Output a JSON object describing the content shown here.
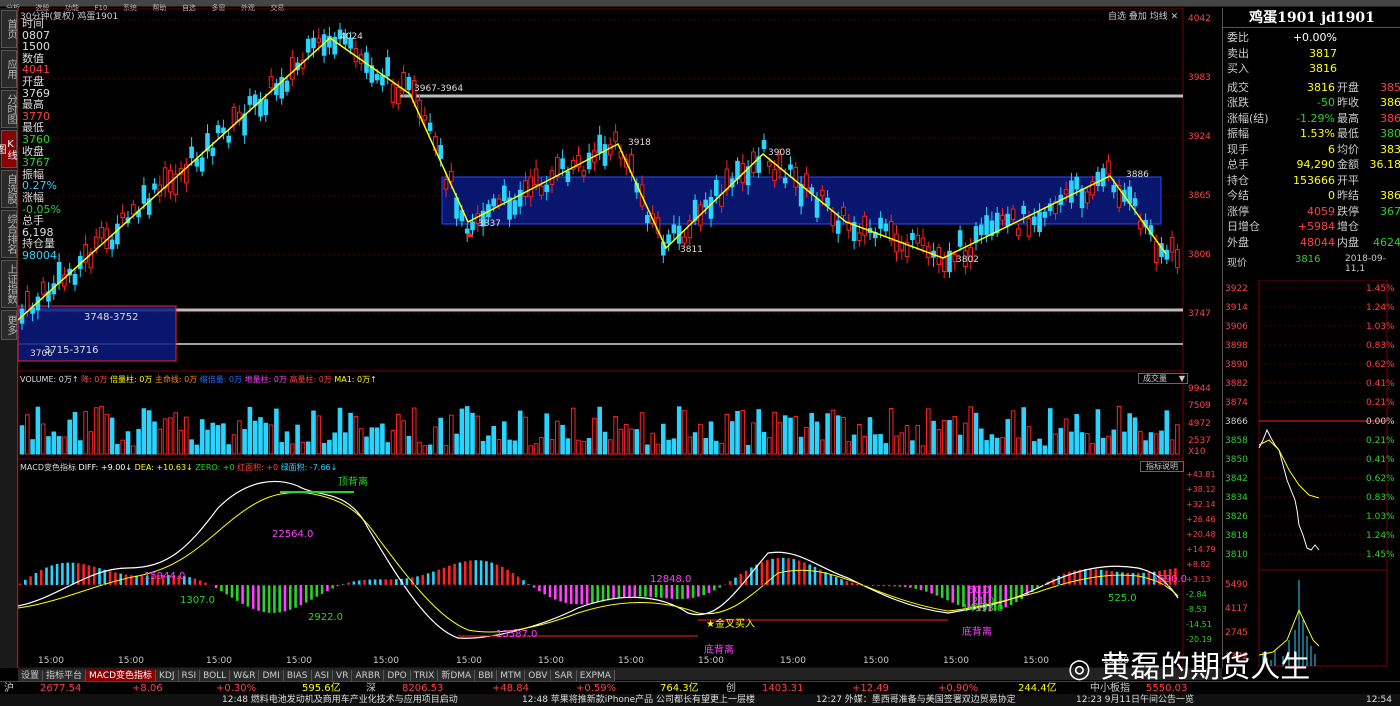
{
  "topbar": {
    "items": [
      "分析",
      "选股",
      "功能",
      "F10",
      "系统",
      "帮助",
      "自选",
      "多窗",
      "外观",
      "交易"
    ]
  },
  "left_tabs": [
    "首页",
    "应用",
    "分时图",
    "K线图",
    "自选股",
    "综合排名",
    "上证指数",
    "更多"
  ],
  "chart": {
    "period_label": "30分钟(复权)",
    "symbol": "鸡蛋1901",
    "toolbar": {
      "self_select": "自选",
      "overlay": "叠加",
      "rights": "均线"
    },
    "info": {
      "time_label": "时间",
      "time_value1": "0807",
      "time_value2": "1500",
      "value_label": "数值",
      "value": "4041",
      "open_label": "开盘",
      "open": "3769",
      "high_label": "最高",
      "high": "3770",
      "low_label": "最低",
      "low": "3760",
      "close_label": "收盘",
      "close": "3767",
      "amp_label": "振幅",
      "amp": "0.27%",
      "chg_label": "涨幅",
      "chg": "-0.05%",
      "vol_label": "总手",
      "vol": "6,198",
      "oi_label": "持仓量",
      "oi": "98004"
    },
    "price_axis": [
      "4042",
      "3983",
      "3924",
      "3865",
      "3806",
      "3747"
    ],
    "annotations": [
      "4024",
      "3967-3964",
      "3918",
      "3908",
      "3886",
      "3837",
      "3811",
      "3802",
      "3748-3752",
      "3715-3716",
      "3706"
    ],
    "volume_header": {
      "volume": "VOLUME: 0万↑",
      "a": "降: 0万",
      "b": "倍量柱: 0万",
      "c": "主命线: 0万",
      "d": "缩倍量: 0万",
      "e": "地量柱: 0万",
      "f": "高量柱: 0万",
      "g": "MA1: 0万↑"
    },
    "volume_axis": [
      "9944",
      "7509",
      "4972",
      "2537",
      "X10"
    ],
    "volume_dropdown": "成交量",
    "macd_header": {
      "name": "MACD变色指标",
      "diff": "DIFF: +9.00↓",
      "dea": "DEA: +10.63↓",
      "zero": "ZERO: +0",
      "red": "红面积: +0",
      "green": "绿面积: -7.66↓"
    },
    "macd_help": "指标说明",
    "macd_axis": [
      "+43.81",
      "+38.12",
      "+32.14",
      "+26.46",
      "+20.48",
      "+14.79",
      "+8.82",
      "+3.13",
      "-2.84",
      "-8.53",
      "-14.51",
      "-20.19"
    ],
    "macd_annotations": [
      "顶背离",
      "22564.0",
      "15944.0",
      "1307.0",
      "2922.0",
      "12848.0",
      "13587.0",
      "金叉买入",
      "底背离",
      "50.0",
      "21.0",
      "14993.0",
      "底背离",
      "525.0",
      "5590.0"
    ],
    "time_axis": [
      "15:00",
      "15:00",
      "15:00",
      "15:00",
      "15:00",
      "15:00",
      "15:00",
      "15:00",
      "15:00",
      "15:00",
      "15:00",
      "15:00",
      "15:00",
      "15:00",
      "15:00",
      "15:00",
      "15:00",
      "15:00",
      "15:00",
      "15:00",
      "15:00",
      "15:00"
    ]
  },
  "bottom_tabs": [
    "设置",
    "指标平台",
    "MACD变色指标",
    "KDJ",
    "RSI",
    "BOLL",
    "W&R",
    "DMI",
    "BIAS",
    "ASI",
    "VR",
    "ARBR",
    "DPO",
    "TRIX",
    "新DMA",
    "BBI",
    "MTM",
    "OBV",
    "SAR",
    "EXPMA"
  ],
  "right_panel": {
    "title": "鸡蛋1901 jd1901",
    "rows": [
      {
        "l": "委比",
        "v": "+0.00%",
        "vc": "#ffffff"
      },
      {
        "l": "卖出",
        "v": "3817",
        "vc": "#ffff00"
      },
      {
        "l": "买入",
        "v": "3816",
        "vc": "#ffff00"
      },
      {
        "l": "成交",
        "v": "3816",
        "vc": "#ffff00",
        "l2": "开盘",
        "v2": "385",
        "v2c": "#ff4040"
      },
      {
        "l": "涨跌",
        "v": "-50",
        "vc": "#29d429",
        "l2": "昨收",
        "v2": "386",
        "v2c": "#ffff00"
      },
      {
        "l": "涨幅(结)",
        "v": "-1.29%",
        "vc": "#29d429",
        "l2": "最高",
        "v2": "386",
        "v2c": "#ff4040"
      },
      {
        "l": "振幅",
        "v": "1.53%",
        "vc": "#ffff00",
        "l2": "最低",
        "v2": "380",
        "v2c": "#29d429"
      },
      {
        "l": "现手",
        "v": "6",
        "vc": "#ffff00",
        "l2": "均价",
        "v2": "383",
        "v2c": "#ffff00"
      },
      {
        "l": "总手",
        "v": "94,290",
        "vc": "#ffff00",
        "l2": "金额",
        "v2": "36.18",
        "v2c": "#ffff00"
      },
      {
        "l": "持仓",
        "v": "153666",
        "vc": "#ffff00",
        "l2": "开平",
        "v2": "",
        "v2c": "#ffff00"
      },
      {
        "l": "今结",
        "v": "0",
        "vc": "#ffff00",
        "l2": "昨结",
        "v2": "386",
        "v2c": "#ffff00"
      },
      {
        "l": "涨停",
        "v": "4059",
        "vc": "#ff4040",
        "l2": "跌停",
        "v2": "367",
        "v2c": "#29d429"
      },
      {
        "l": "日增仓",
        "v": "+5984",
        "vc": "#ff4040",
        "l2": "增仓",
        "v2": "",
        "v2c": "#ffff00"
      },
      {
        "l": "外盘",
        "v": "48044",
        "vc": "#ff4040",
        "l2": "内盘",
        "v2": "4624",
        "v2c": "#29d429"
      }
    ],
    "now_label": "现价",
    "now_price": "3816",
    "now_date": "2018-09-11,1",
    "mini_axis_left": [
      "3922",
      "3914",
      "3906",
      "3898",
      "3890",
      "3882",
      "3874",
      "3866",
      "3858",
      "3850",
      "3842",
      "3834",
      "3826",
      "3818",
      "3810"
    ],
    "mini_axis_right": [
      "1.45%",
      "1.24%",
      "1.03%",
      "0.83%",
      "0.62%",
      "0.41%",
      "0.21%",
      "0.00%",
      "0.21%",
      "0.41%",
      "0.62%",
      "0.83%",
      "1.03%",
      "1.24%",
      "1.45%"
    ],
    "mini_vol_axis": [
      "5490",
      "4117",
      "2745",
      "1372"
    ]
  },
  "status": {
    "sh_label": "沪",
    "sh_val": "2677.54",
    "sh_chg": "+8.06",
    "sh_pct": "+0.30%",
    "sh_amt": "595.6亿",
    "sz_label": "深",
    "sz_val": "8206.53",
    "sz_chg": "+48.84",
    "sz_pct": "+0.59%",
    "sz_amt": "764.3亿",
    "cy_label": "创",
    "cy_val": "1403.31",
    "cy_chg": "+12.49",
    "cy_pct": "+0.90%",
    "cy_amt": "244.4亿",
    "extra": "中小板指",
    "extra_val": "5550.03"
  },
  "news": {
    "a": "12:48 燃料电池发动机及商用车产业化技术与应用项目启动",
    "b": "12:48 苹果将推新款iPhone产品 公司都长有望更上一层楼",
    "c": "12:27 外媒：墨西哥准备与美国签署双边贸易协定",
    "d": "12:23 9月11日午间公告一览",
    "time": "12:54"
  },
  "watermark": "黄磊的期货人生"
}
